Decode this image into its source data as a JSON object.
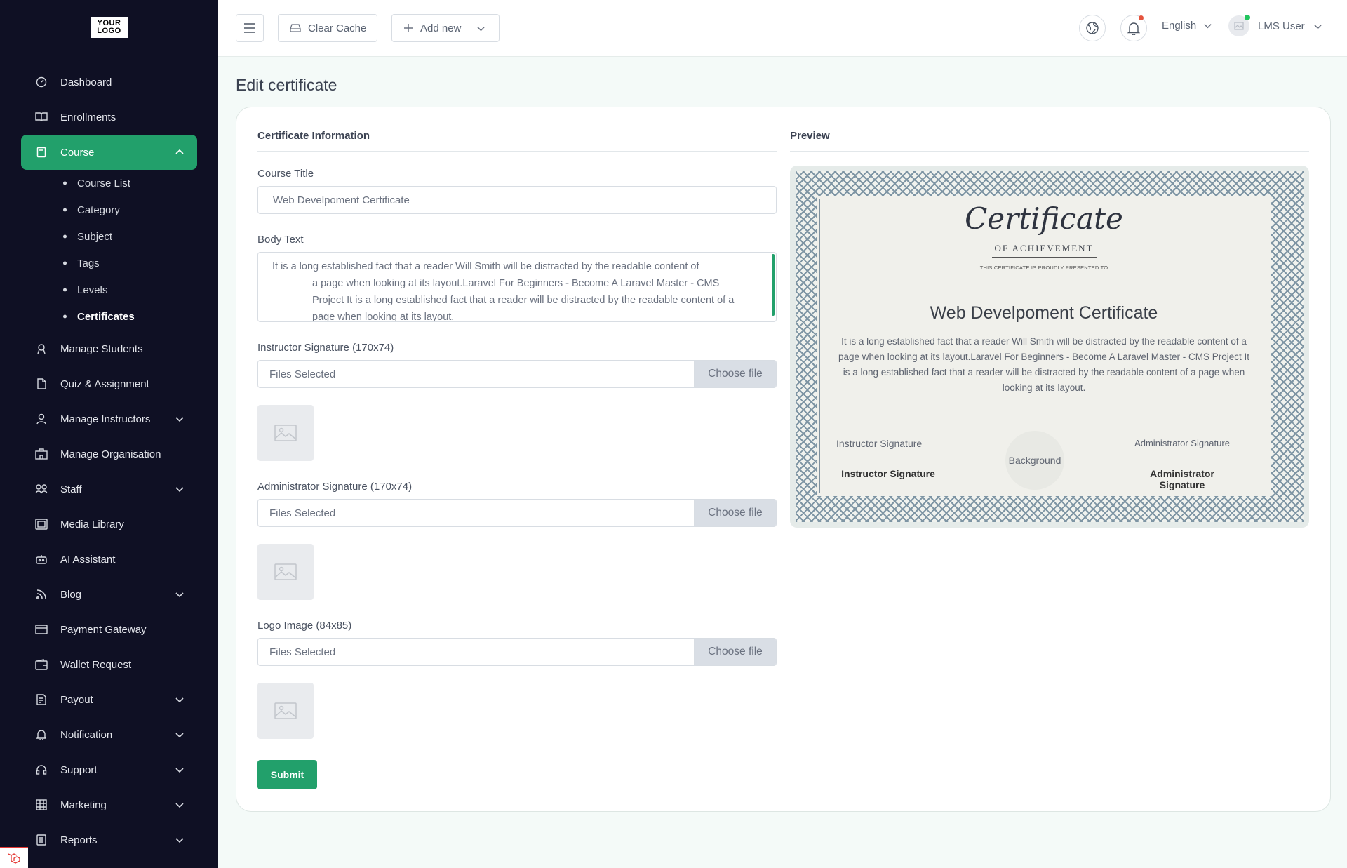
{
  "sidebar": {
    "logo_line1": "YOUR",
    "logo_line2": "LOGO",
    "items": [
      {
        "label": "Dashboard"
      },
      {
        "label": "Enrollments"
      },
      {
        "label": "Course"
      },
      {
        "label": "Manage Students"
      },
      {
        "label": "Quiz & Assignment"
      },
      {
        "label": "Manage Instructors"
      },
      {
        "label": "Manage Organisation"
      },
      {
        "label": "Staff"
      },
      {
        "label": "Media Library"
      },
      {
        "label": "AI Assistant"
      },
      {
        "label": "Blog"
      },
      {
        "label": "Payment Gateway"
      },
      {
        "label": "Wallet Request"
      },
      {
        "label": "Payout"
      },
      {
        "label": "Notification"
      },
      {
        "label": "Support"
      },
      {
        "label": "Marketing"
      },
      {
        "label": "Reports"
      }
    ],
    "course_sub": [
      {
        "label": "Course List"
      },
      {
        "label": "Category"
      },
      {
        "label": "Subject"
      },
      {
        "label": "Tags"
      },
      {
        "label": "Levels"
      },
      {
        "label": "Certificates"
      }
    ]
  },
  "topbar": {
    "clear_cache": "Clear Cache",
    "add_new": "Add new",
    "language": "English",
    "user": "LMS User"
  },
  "page": {
    "title": "Edit certificate",
    "info_heading": "Certificate Information",
    "preview_heading": "Preview",
    "course_title_label": "Course Title",
    "course_title_value": "Web Develpoment Certificate",
    "body_text_label": "Body Text",
    "body_text_line1": "It is a long established fact that a reader Will Smith will be distracted by the readable content of",
    "body_text_line2": "a page when looking at its layout.Laravel For Beginners - Become A Laravel Master - CMS",
    "body_text_line3": "Project It is a long established fact that a reader will be distracted by the readable content of a",
    "body_text_line4": "page when looking at its layout.",
    "instructor_sig_label": "Instructor Signature (170x74)",
    "admin_sig_label": "Administrator Signature (170x74)",
    "logo_label": "Logo Image (84x85)",
    "files_selected": "Files Selected",
    "choose_file": "Choose file",
    "submit": "Submit"
  },
  "certificate": {
    "script_title": "Certificate",
    "subtitle": "OF ACHIEVEMENT",
    "presented": "THIS CERTIFICATE IS PROUDLY PRESENTED TO",
    "course": "Web Develpoment Certificate",
    "body": "It is a long established fact that a reader Will Smith will be distracted by the readable content of a page when looking at its layout.Laravel For Beginners - Become A Laravel Master - CMS Project It is a long established fact that a reader will be distracted by the readable content of a page when looking at its layout.",
    "instructor_alt": "Instructor Signature",
    "instructor_name": "Instructor Signature",
    "background_alt": "Background",
    "admin_alt": "Administrator Signature",
    "admin_name": "Administrator Signature"
  },
  "colors": {
    "sidebar_bg": "#0f1024",
    "accent": "#22a06b",
    "page_bg": "#f4faf8",
    "notify_dot": "#e5533d",
    "online_dot": "#22c55e"
  },
  "icons": {
    "menu": "hamburger-icon",
    "cache": "drive-icon",
    "add": "plus-icon",
    "globe": "globe-icon",
    "bell": "bell-icon",
    "image": "image-placeholder-icon"
  }
}
